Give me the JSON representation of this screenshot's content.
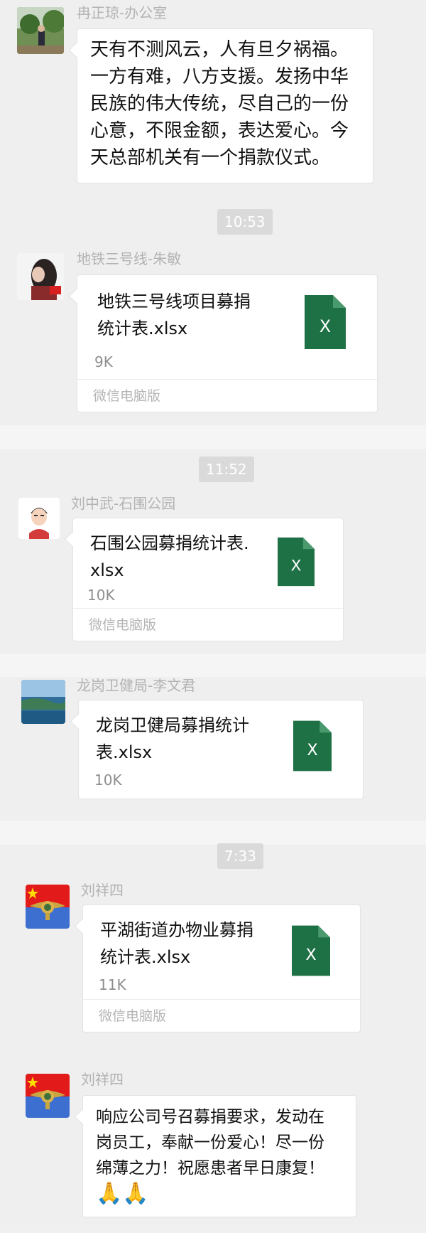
{
  "colors": {
    "xlsx_green": "#1e7145",
    "timestamp_bg": "#dadada",
    "name_gray": "#b3b3b3"
  },
  "timestamps": [
    "10:53",
    "11:52",
    "7:33"
  ],
  "messages": [
    {
      "sender": "冉正琼-办公室",
      "avatar_icon": "photo-avatar-landscape",
      "lines": [
        "天有不测风云，人有旦夕祸福。",
        "一方有难，八方支援。发扬中华",
        "民族的伟大传统，尽自己的一份",
        "心意，不限金额，表达爱心。今",
        "天总部机关有一个捐款仪式。"
      ]
    },
    {
      "sender": "地铁三号线-朱敏",
      "avatar_icon": "photo-avatar-girl",
      "file_lines": [
        "地铁三号线项目募捐",
        "统计表.xlsx"
      ],
      "file_size": "9K",
      "source": "微信电脑版",
      "file_icon": "excel-file-icon"
    },
    {
      "sender": "刘中武-石围公园",
      "avatar_icon": "cartoon-avatar-man",
      "file_lines": [
        "石围公园募捐统计表.",
        "xlsx"
      ],
      "file_size": "10K",
      "source": "微信电脑版",
      "file_icon": "excel-file-icon"
    },
    {
      "sender": "龙岗卫健局-李文君",
      "avatar_icon": "photo-avatar-sea",
      "file_lines": [
        "龙岗卫健局募捐统计",
        "表.xlsx"
      ],
      "file_size": "10K",
      "file_icon": "excel-file-icon"
    },
    {
      "sender": "刘祥四",
      "avatar_icon": "army-badge-avatar",
      "file_lines": [
        "平湖街道办物业募捐",
        "统计表.xlsx"
      ],
      "file_size": "11K",
      "source": "微信电脑版",
      "file_icon": "excel-file-icon"
    },
    {
      "sender": "刘祥四",
      "avatar_icon": "army-badge-avatar",
      "lines": [
        "响应公司号召募捐要求，发动在",
        "岗员工，奉献一份爱心！尽一份",
        "绵薄之力！祝愿患者早日康复！"
      ],
      "emoji": "🙏🙏"
    }
  ],
  "excel_glyph": "X"
}
